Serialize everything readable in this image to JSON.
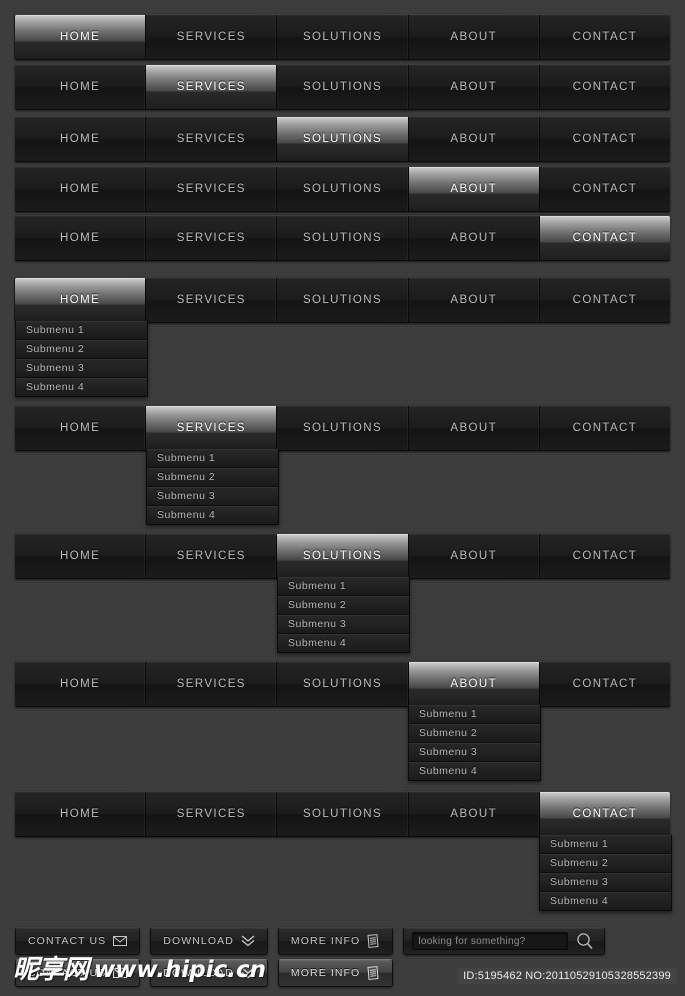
{
  "background_color": "#3b3b3b",
  "nav": {
    "tabs": [
      "HOME",
      "SERVICES",
      "SOLUTIONS",
      "ABOUT",
      "CONTACT"
    ],
    "submenu_items": [
      "Submenu 1",
      "Submenu 2",
      "Submenu 3",
      "Submenu 4"
    ],
    "rows": [
      {
        "active_index": 0,
        "submenu_open": false
      },
      {
        "active_index": 1,
        "submenu_open": false
      },
      {
        "active_index": 2,
        "submenu_open": false
      },
      {
        "active_index": 3,
        "submenu_open": false
      },
      {
        "active_index": 4,
        "submenu_open": false
      },
      {
        "active_index": 0,
        "submenu_open": true
      },
      {
        "active_index": 1,
        "submenu_open": true
      },
      {
        "active_index": 2,
        "submenu_open": true
      },
      {
        "active_index": 3,
        "submenu_open": true
      },
      {
        "active_index": 4,
        "submenu_open": true
      }
    ]
  },
  "buttons": {
    "contact": {
      "label": "CONTACT US",
      "icon": "envelope-icon"
    },
    "download": {
      "label": "DOWNLOAD",
      "icon": "chevron-double-down-icon"
    },
    "more_info": {
      "label": "MORE INFO",
      "icon": "document-icon"
    }
  },
  "search": {
    "placeholder": "looking for something?",
    "value": "",
    "icon": "magnifier-icon"
  },
  "watermark": {
    "cjk": "昵享网",
    "url": "www.hipic.cn"
  },
  "id_tag": "ID:5195462 NO:20110529105328552399",
  "colors": {
    "active_tab_highlight": "#cfcfcf",
    "tab_text": "#bdbdbd",
    "active_tab_text": "#ffffff",
    "bar_background": "#1a1a1a",
    "submenu_background": "#202020"
  }
}
